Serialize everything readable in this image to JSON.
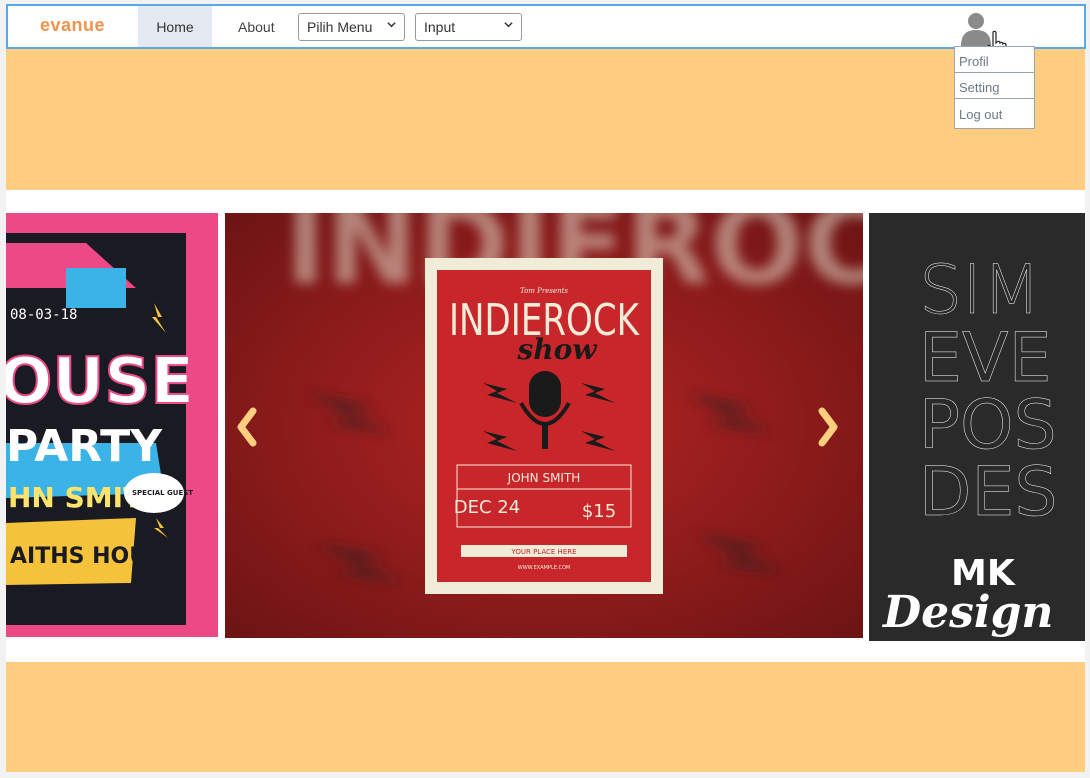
{
  "navbar": {
    "brand": "evanue",
    "home_label": "Home",
    "about_label": "About",
    "menu_select_value": "Pilih Menu",
    "input_select_value": "Input"
  },
  "user_menu": {
    "items": [
      "Profil",
      "Setting",
      "Log out"
    ]
  },
  "carousel": {
    "left_slide": {
      "date": "08-03-18",
      "title_line1": "OUSE",
      "title_line2": "PARTY",
      "performer": "HN SMITH",
      "badge": "SPECIAL GUEST",
      "venue": "AITHS HOUSE"
    },
    "center_slide": {
      "kicker": "Tom Presents",
      "title": "INDIEROCK",
      "script": "show",
      "performer": "JOHN SMITH",
      "date": "DEC 24",
      "price": "$15",
      "place": "YOUR PLACE HERE",
      "website": "WWW.EXAMPLE.COM"
    },
    "right_slide": {
      "lines": [
        "SIM",
        "EVE",
        "POS",
        "DES"
      ],
      "brand_line1": "MK",
      "brand_line2": "Design"
    }
  },
  "colors": {
    "accent_band": "#fecd80",
    "brand": "#f4924b",
    "nav_border": "#5aa9e6",
    "arrow": "#fdcf7e"
  }
}
